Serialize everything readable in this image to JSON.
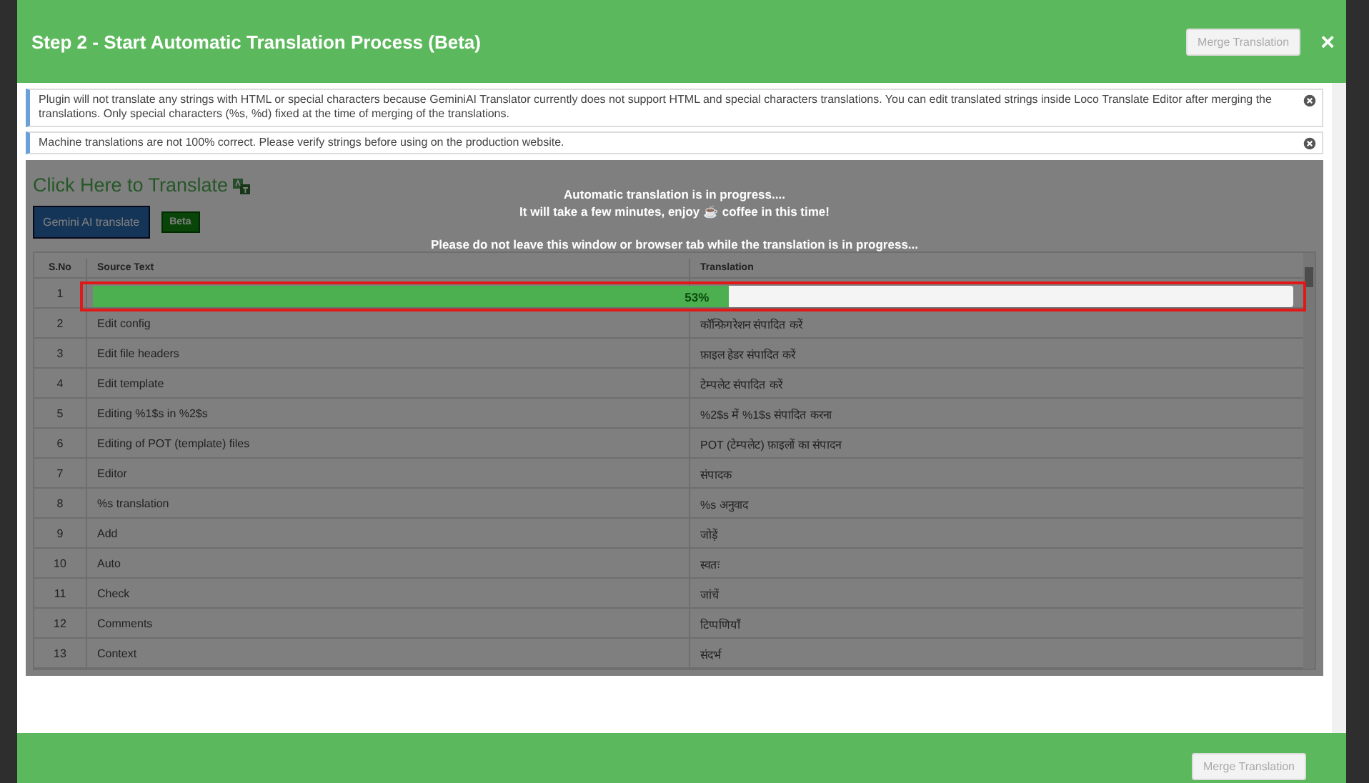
{
  "modal": {
    "title": "Step 2 - Start Automatic Translation Process (Beta)",
    "header_button": "Merge Translation",
    "close": "×"
  },
  "notices": [
    "Plugin will not translate any strings with HTML or special characters because GeminiAI Translator currently does not support HTML and special characters translations. You can edit translated strings inside Loco Translate Editor after merging the translations. Only special characters (%s, %d) fixed at the time of merging of the translations.",
    "Machine translations are not 100% correct. Please verify strings before using on the production website."
  ],
  "translate_heading": "Click Here to Translate",
  "translate_button": "Gemini AI translate",
  "beta_badge": "Beta",
  "progress": {
    "messages": [
      "Automatic translation is in progress....",
      "It will take a few minutes, enjoy ☕ coffee in this time!",
      "Please do not leave this window or browser tab while the translation is in progress..."
    ],
    "level": 0.53,
    "label": "53%"
  },
  "table": {
    "columns": [
      "S.No",
      "Source Text",
      "Translation"
    ],
    "rows": [
      {
        "no": "1",
        "source": "",
        "translation": ""
      },
      {
        "no": "2",
        "source": "Edit config",
        "translation": "कॉन्फ़िगरेशन संपादित करें"
      },
      {
        "no": "3",
        "source": "Edit file headers",
        "translation": "फ़ाइल हेडर संपादित करें"
      },
      {
        "no": "4",
        "source": "Edit template",
        "translation": "टेम्पलेट संपादित करें"
      },
      {
        "no": "5",
        "source": "Editing %1$s in %2$s",
        "translation": "%2$s में %1$s संपादित करना"
      },
      {
        "no": "6",
        "source": "Editing of POT (template) files",
        "translation": "POT (टेम्पलेट) फ़ाइलों का संपादन"
      },
      {
        "no": "7",
        "source": "Editor",
        "translation": "संपादक"
      },
      {
        "no": "8",
        "source": "%s translation",
        "translation": "%s अनुवाद"
      },
      {
        "no": "9",
        "source": "Add",
        "translation": "जोड़ें"
      },
      {
        "no": "10",
        "source": "Auto",
        "translation": "स्वतः"
      },
      {
        "no": "11",
        "source": "Check",
        "translation": "जांचें"
      },
      {
        "no": "12",
        "source": "Comments",
        "translation": "टिप्पणियाँ"
      },
      {
        "no": "13",
        "source": "Context",
        "translation": "संदर्भ"
      }
    ]
  },
  "footer_button": "Merge Translation"
}
